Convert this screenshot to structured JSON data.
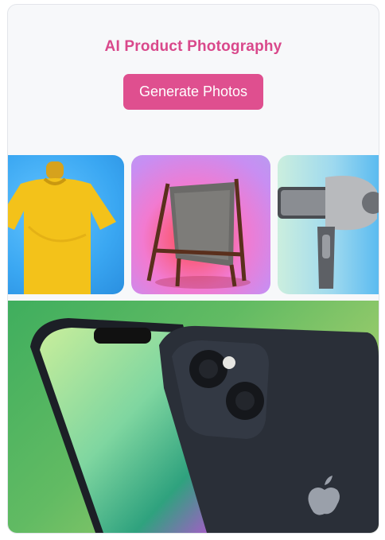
{
  "header": {
    "title": "AI Product Photography",
    "cta_label": "Generate Photos"
  },
  "gallery": {
    "items": [
      {
        "subject": "yellow t-shirt on mannequin"
      },
      {
        "subject": "wooden sling chair"
      },
      {
        "subject": "hair dryer"
      }
    ]
  },
  "hero": {
    "subject": "smartphone back and front"
  },
  "colors": {
    "accent": "#df4f8f",
    "title": "#d9488b",
    "card_bg": "#f7f8fa"
  },
  "icons": [
    "tshirt-image",
    "chair-image",
    "hair-dryer-image",
    "smartphone-image",
    "apple-logo-icon"
  ]
}
